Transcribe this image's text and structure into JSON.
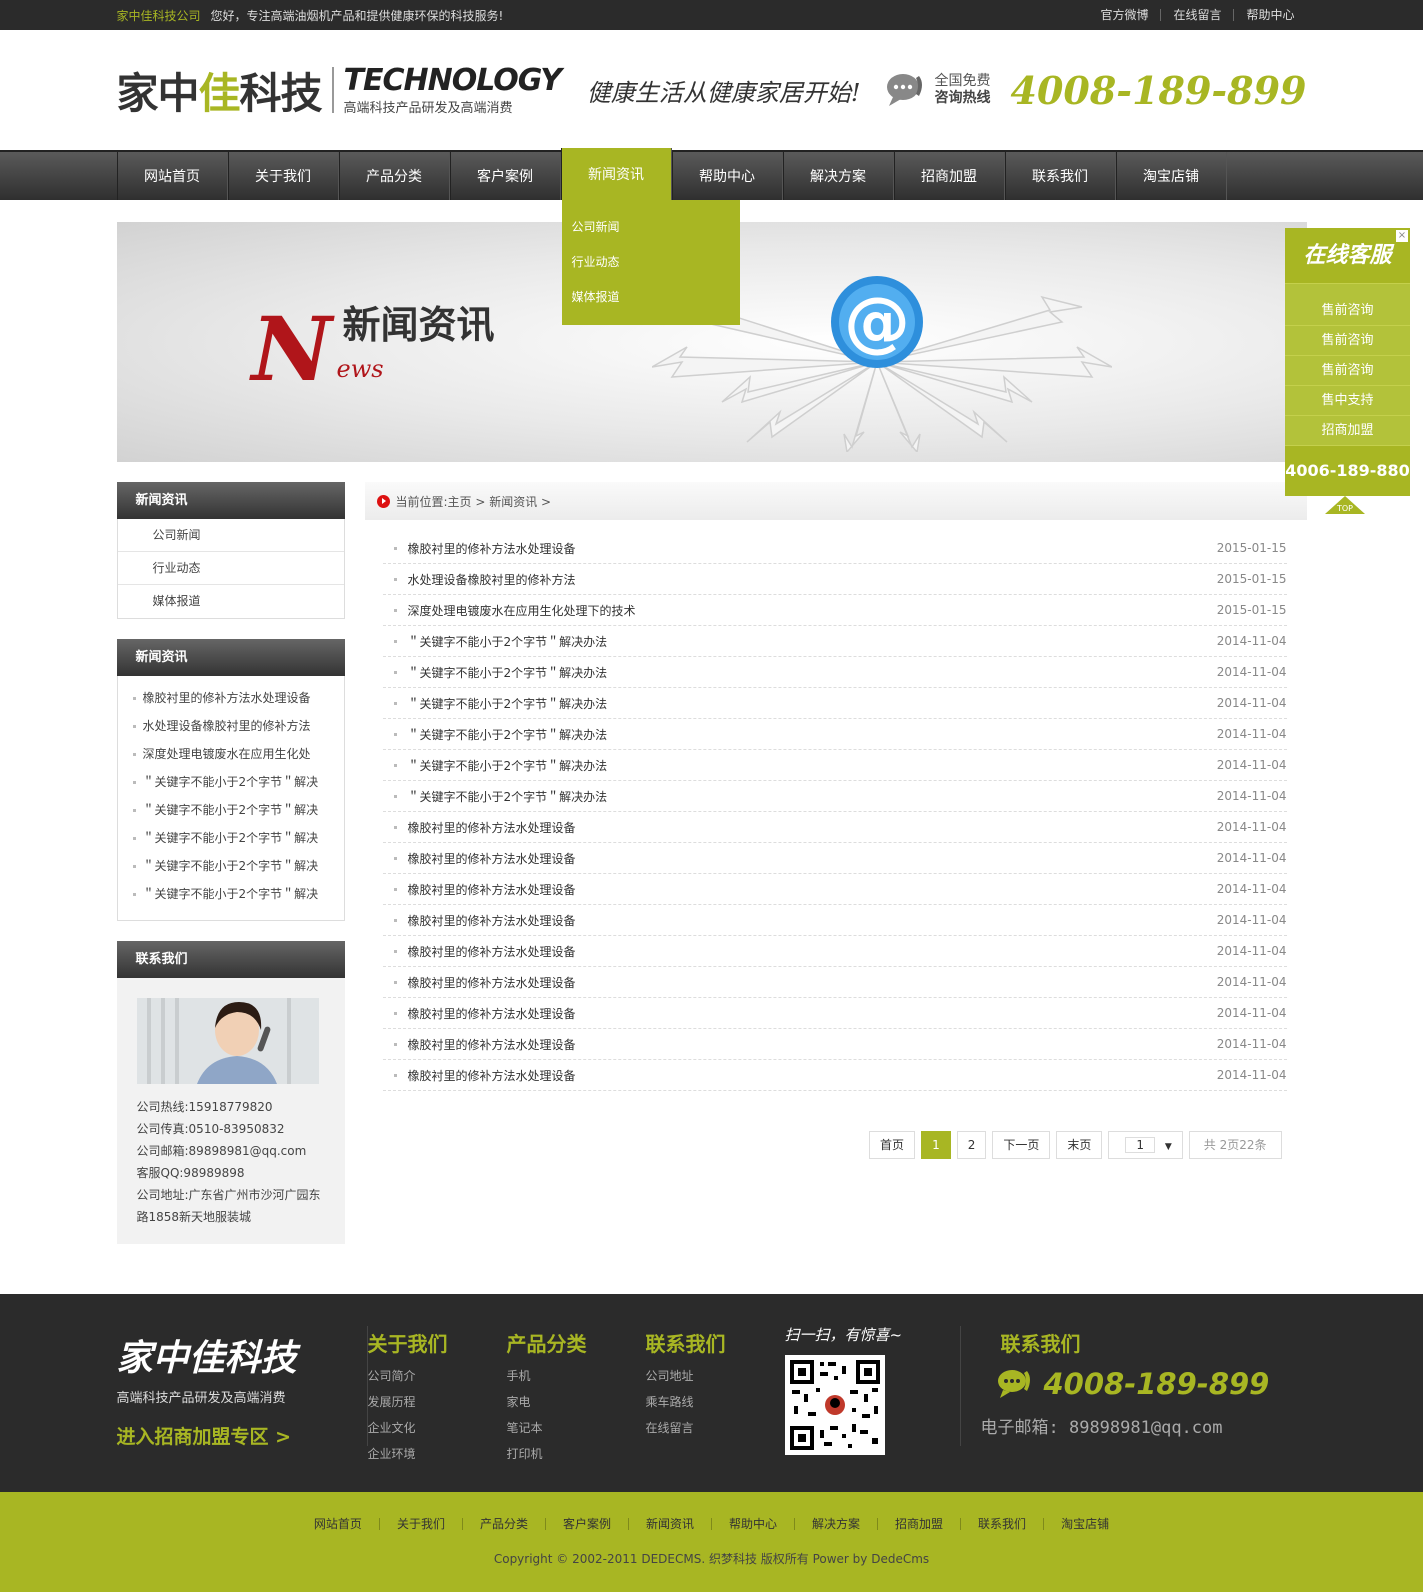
{
  "topbar": {
    "brand": "家中佳科技公司",
    "greeting": "您好，专注高端油烟机产品和提供健康环保的科技服务!",
    "links": [
      "官方微博",
      "在线留言",
      "帮助中心"
    ]
  },
  "header": {
    "logo_cn_dark": "家中",
    "logo_cn_green": "佳",
    "logo_cn_dark2": "科技",
    "logo_en": "TECHNOLOGY",
    "logo_sub": "高端科技产品研发及高端消费",
    "slogan": "健康生活从健康家居开始!",
    "hotline_line1": "全国免费",
    "hotline_line2": "咨询热线",
    "hotline_number": "4008-189-899"
  },
  "nav": {
    "items": [
      "网站首页",
      "关于我们",
      "产品分类",
      "客户案例",
      "新闻资讯",
      "帮助中心",
      "解决方案",
      "招商加盟",
      "联系我们",
      "淘宝店铺"
    ],
    "dropdown": [
      "公司新闻",
      "行业动态",
      "媒体报道"
    ]
  },
  "banner": {
    "letter": "N",
    "rest": "ews",
    "title": "新闻资讯"
  },
  "sidebar": {
    "menu_title": "新闻资讯",
    "menu": [
      "公司新闻",
      "行业动态",
      "媒体报道"
    ],
    "list_title": "新闻资讯",
    "list": [
      "橡胶衬里的修补方法水处理设备",
      "水处理设备橡胶衬里的修补方法",
      "深度处理电镀废水在应用生化处",
      "＂关键字不能小于2个字节＂解决",
      "＂关键字不能小于2个字节＂解决",
      "＂关键字不能小于2个字节＂解决",
      "＂关键字不能小于2个字节＂解决",
      "＂关键字不能小于2个字节＂解决"
    ],
    "contact_title": "联系我们",
    "contact": [
      "公司热线:15918779820",
      "公司传真:0510-83950832",
      "公司邮箱:89898981@qq.com",
      "客服QQ:98989898",
      "公司地址:广东省广州市沙河广园东路1858新天地服装城"
    ]
  },
  "breadcrumb": "当前位置:主页 > 新闻资讯 >",
  "news": [
    {
      "title": "橡胶衬里的修补方法水处理设备",
      "date": "2015-01-15"
    },
    {
      "title": "水处理设备橡胶衬里的修补方法",
      "date": "2015-01-15"
    },
    {
      "title": "深度处理电镀废水在应用生化处理下的技术",
      "date": "2015-01-15"
    },
    {
      "title": "＂关键字不能小于2个字节＂解决办法",
      "date": "2014-11-04"
    },
    {
      "title": "＂关键字不能小于2个字节＂解决办法",
      "date": "2014-11-04"
    },
    {
      "title": "＂关键字不能小于2个字节＂解决办法",
      "date": "2014-11-04"
    },
    {
      "title": "＂关键字不能小于2个字节＂解决办法",
      "date": "2014-11-04"
    },
    {
      "title": "＂关键字不能小于2个字节＂解决办法",
      "date": "2014-11-04"
    },
    {
      "title": "＂关键字不能小于2个字节＂解决办法",
      "date": "2014-11-04"
    },
    {
      "title": "橡胶衬里的修补方法水处理设备",
      "date": "2014-11-04"
    },
    {
      "title": "橡胶衬里的修补方法水处理设备",
      "date": "2014-11-04"
    },
    {
      "title": "橡胶衬里的修补方法水处理设备",
      "date": "2014-11-04"
    },
    {
      "title": "橡胶衬里的修补方法水处理设备",
      "date": "2014-11-04"
    },
    {
      "title": "橡胶衬里的修补方法水处理设备",
      "date": "2014-11-04"
    },
    {
      "title": "橡胶衬里的修补方法水处理设备",
      "date": "2014-11-04"
    },
    {
      "title": "橡胶衬里的修补方法水处理设备",
      "date": "2014-11-04"
    },
    {
      "title": "橡胶衬里的修补方法水处理设备",
      "date": "2014-11-04"
    },
    {
      "title": "橡胶衬里的修补方法水处理设备",
      "date": "2014-11-04"
    }
  ],
  "pager": {
    "first": "首页",
    "pages": [
      "1",
      "2"
    ],
    "next": "下一页",
    "last": "末页",
    "select": "1",
    "total": "共 2页22条"
  },
  "service": {
    "title": "在线客服",
    "close": "×",
    "items": [
      "售前咨询",
      "售前咨询",
      "售前咨询",
      "售中支持",
      "招商加盟"
    ],
    "phone": "4006-189-880",
    "top": "TOP"
  },
  "footer": {
    "brand": "家中佳科技",
    "sub": "高端科技产品研发及高端消费",
    "join": "进入招商加盟专区 >",
    "cols": [
      {
        "title": "关于我们",
        "items": [
          "公司简介",
          "发展历程",
          "企业文化",
          "企业环境"
        ]
      },
      {
        "title": "产品分类",
        "items": [
          "手机",
          "家电",
          "笔记本",
          "打印机"
        ]
      },
      {
        "title": "联系我们",
        "items": [
          "公司地址",
          "乘车路线",
          "在线留言"
        ]
      }
    ],
    "qr_caption": "扫一扫，有惊喜~",
    "contact_title": "联系我们",
    "phone": "4008-189-899",
    "email": "电子邮箱: 89898981@qq.com"
  },
  "bottom": {
    "links": [
      "网站首页",
      "关于我们",
      "产品分类",
      "客户案例",
      "新闻资讯",
      "帮助中心",
      "解决方案",
      "招商加盟",
      "联系我们",
      "淘宝店铺"
    ],
    "copyright": "Copyright © 2002-2011 DEDECMS. 织梦科技 版权所有 Power by DedeCms"
  },
  "colors": {
    "accent": "#a8b623",
    "dark": "#2b2b2b"
  }
}
